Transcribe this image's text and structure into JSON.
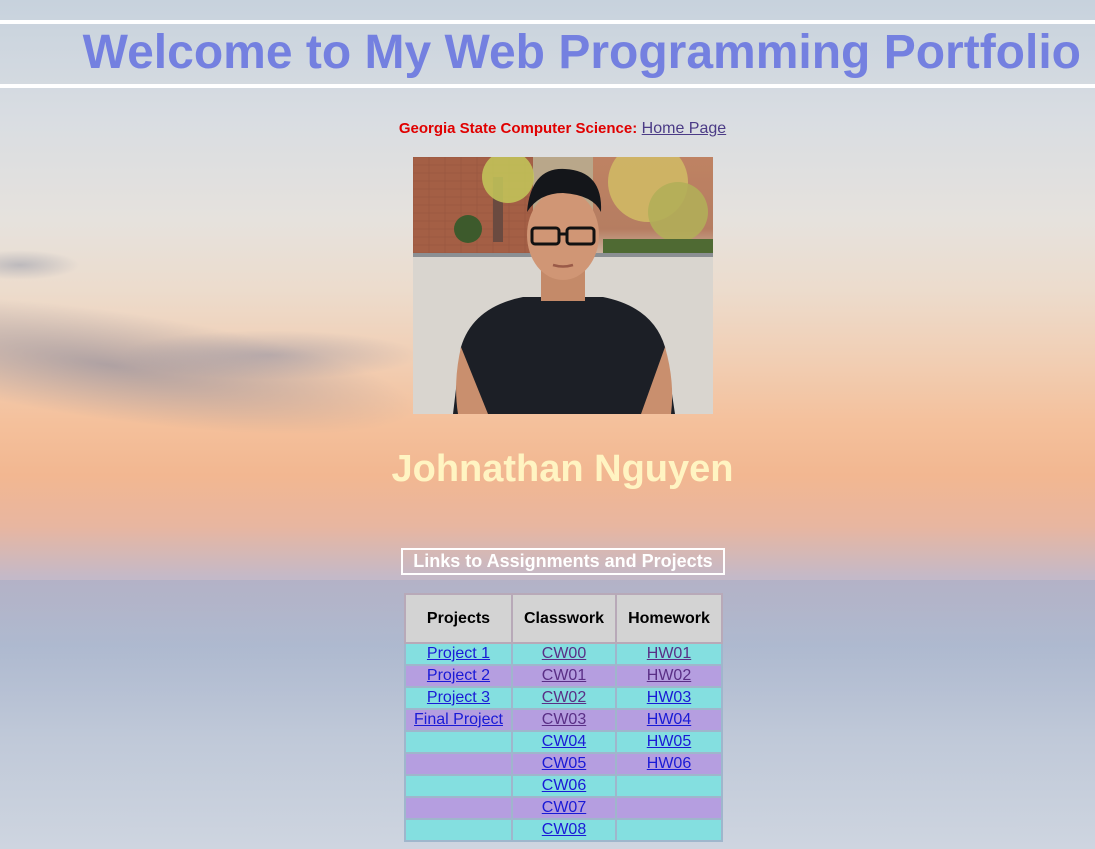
{
  "header": {
    "title": "Welcome to My Web Programming Portfolio"
  },
  "dept": {
    "label": "Georgia State Computer Science:",
    "link_text": "Home Page"
  },
  "profile": {
    "name": "Johnathan Nguyen"
  },
  "links_section": {
    "heading": "Links to Assignments and Projects"
  },
  "table": {
    "headers": [
      "Projects",
      "Classwork",
      "Homework"
    ],
    "rows": [
      [
        "Project 1",
        "CW00",
        "HW01"
      ],
      [
        "Project 2",
        "CW01",
        "HW02"
      ],
      [
        "Project 3",
        "CW02",
        "HW03"
      ],
      [
        "Final Project",
        "CW03",
        "HW04"
      ],
      [
        "",
        "CW04",
        "HW05"
      ],
      [
        "",
        "CW05",
        "HW06"
      ],
      [
        "",
        "CW06",
        ""
      ],
      [
        "",
        "CW07",
        ""
      ],
      [
        "",
        "CW08",
        ""
      ]
    ]
  },
  "colors": {
    "title": "#7480e0",
    "dept_label": "#e00000",
    "name": "#fff4c2",
    "row_cyan": "#84dfe0",
    "row_purple": "#b59ee0",
    "link_unvisited": "#1a1ad6",
    "link_visited": "#5a2f86"
  }
}
